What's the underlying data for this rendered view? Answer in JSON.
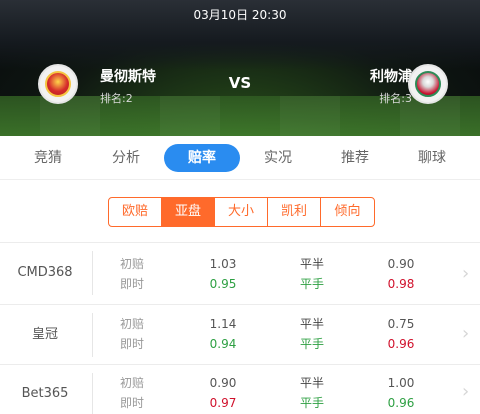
{
  "match": {
    "datetime": "03月10日 20:30",
    "vs": "VS",
    "home": {
      "name": "曼彻斯特",
      "rank": "排名:2"
    },
    "away": {
      "name": "利物浦",
      "rank": "排名:3"
    }
  },
  "tabs": [
    {
      "label": "竞猜"
    },
    {
      "label": "分析"
    },
    {
      "label": "赔率",
      "active": true
    },
    {
      "label": "实况"
    },
    {
      "label": "推荐"
    },
    {
      "label": "聊球"
    }
  ],
  "odds_types": [
    {
      "label": "欧赔"
    },
    {
      "label": "亚盘",
      "active": true
    },
    {
      "label": "大小"
    },
    {
      "label": "凯利"
    },
    {
      "label": "倾向"
    }
  ],
  "rows_labels": {
    "initial": "初赔",
    "live": "即时"
  },
  "rows": [
    {
      "bookie": "CMD368",
      "initial": {
        "home": "1.03",
        "handicap": "平半",
        "away": "0.90"
      },
      "live": {
        "home": "0.95",
        "handicap": "平手",
        "away": "0.98"
      }
    },
    {
      "bookie": "皇冠",
      "initial": {
        "home": "1.14",
        "handicap": "平半",
        "away": "0.75"
      },
      "live": {
        "home": "0.94",
        "handicap": "平手",
        "away": "0.96"
      }
    },
    {
      "bookie": "Bet365",
      "initial": {
        "home": "0.90",
        "handicap": "平半",
        "away": "1.00"
      },
      "live": {
        "home": "0.97",
        "handicap": "平手",
        "away": "0.96"
      }
    }
  ],
  "colors": {
    "accent_tab": "#2a8cf0",
    "accent_segment": "#ff6a2b",
    "up": "#d0102b",
    "down": "#2ea043"
  }
}
